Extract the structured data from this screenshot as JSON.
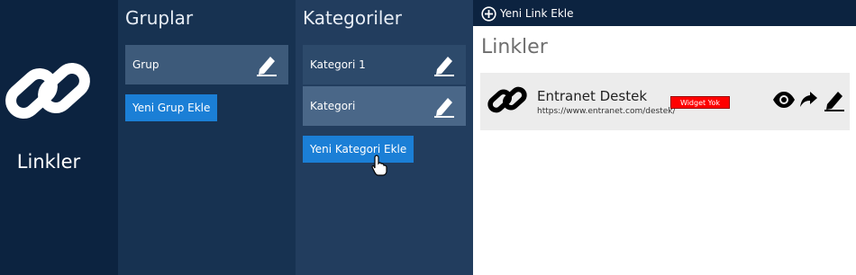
{
  "brand": {
    "title": "Linkler",
    "icon": "chain-link-icon"
  },
  "groups": {
    "title": "Gruplar",
    "items": [
      {
        "label": "Grup",
        "icon": "pencil-icon"
      }
    ],
    "add_label": "Yeni Grup Ekle"
  },
  "categories": {
    "title": "Kategoriler",
    "items": [
      {
        "label": "Kategori 1",
        "icon": "pencil-icon"
      },
      {
        "label": "Kategori",
        "icon": "pencil-icon"
      }
    ],
    "add_label": "Yeni Kategori Ekle"
  },
  "links": {
    "topbar_add_label": "Yeni Link Ekle",
    "title": "Linkler",
    "items": [
      {
        "name": "Entranet Destek",
        "url": "https://www.entranet.com/destek/",
        "badge": "Widget Yok",
        "actions": [
          "eye-icon",
          "share-icon",
          "pencil-icon"
        ]
      }
    ]
  },
  "colors": {
    "brand_bg": "#0c2340",
    "groups_bg": "#173251",
    "categories_bg": "#223d5e",
    "button_blue": "#1b7fd6",
    "badge_red": "#ff0000"
  }
}
